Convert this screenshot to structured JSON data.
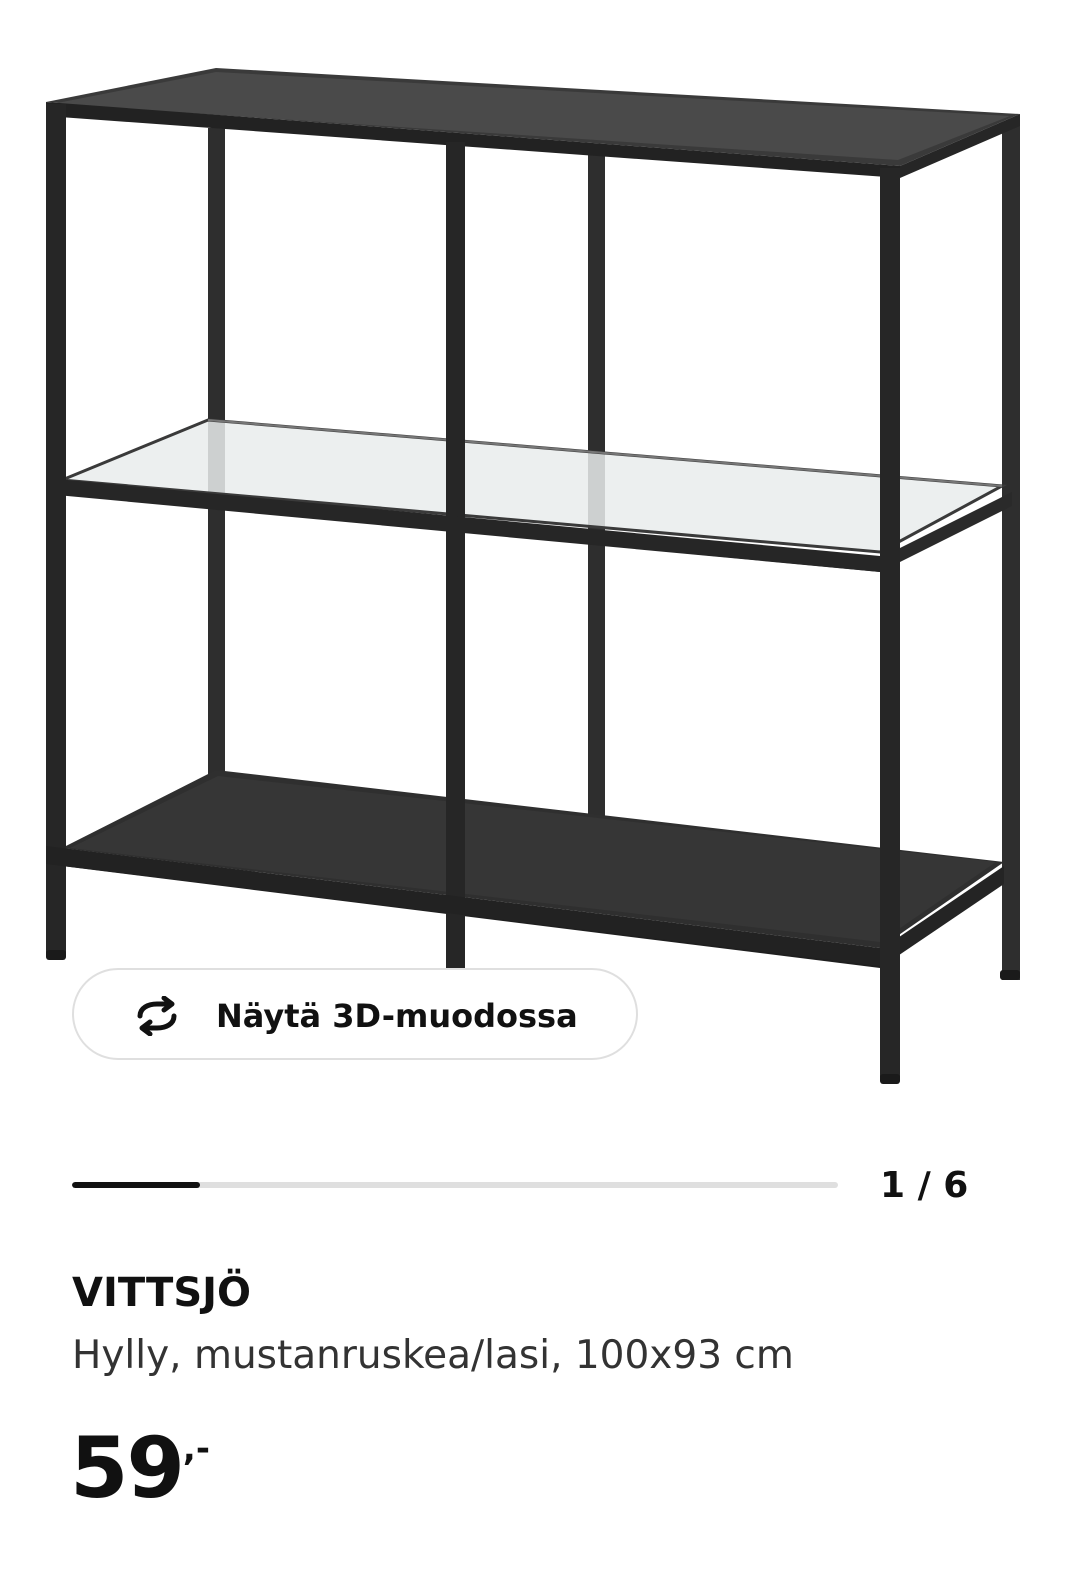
{
  "product_image": {
    "alt": "VITTSJÖ"
  },
  "view_3d": {
    "label": "Näytä 3D-muodossa",
    "icon": "rotate-3d-icon"
  },
  "gallery": {
    "current": 1,
    "total": 6,
    "indicator": "1 / 6",
    "progress_fraction": 0.1667
  },
  "product": {
    "name": "VITTSJÖ",
    "description": "Hylly, mustanruskea/lasi, 100x93 cm",
    "price_integer": "59",
    "price_decimal": ",-"
  },
  "colors": {
    "frame": "#2b2b2b",
    "text": "#111111",
    "border": "#dfdfdf"
  }
}
